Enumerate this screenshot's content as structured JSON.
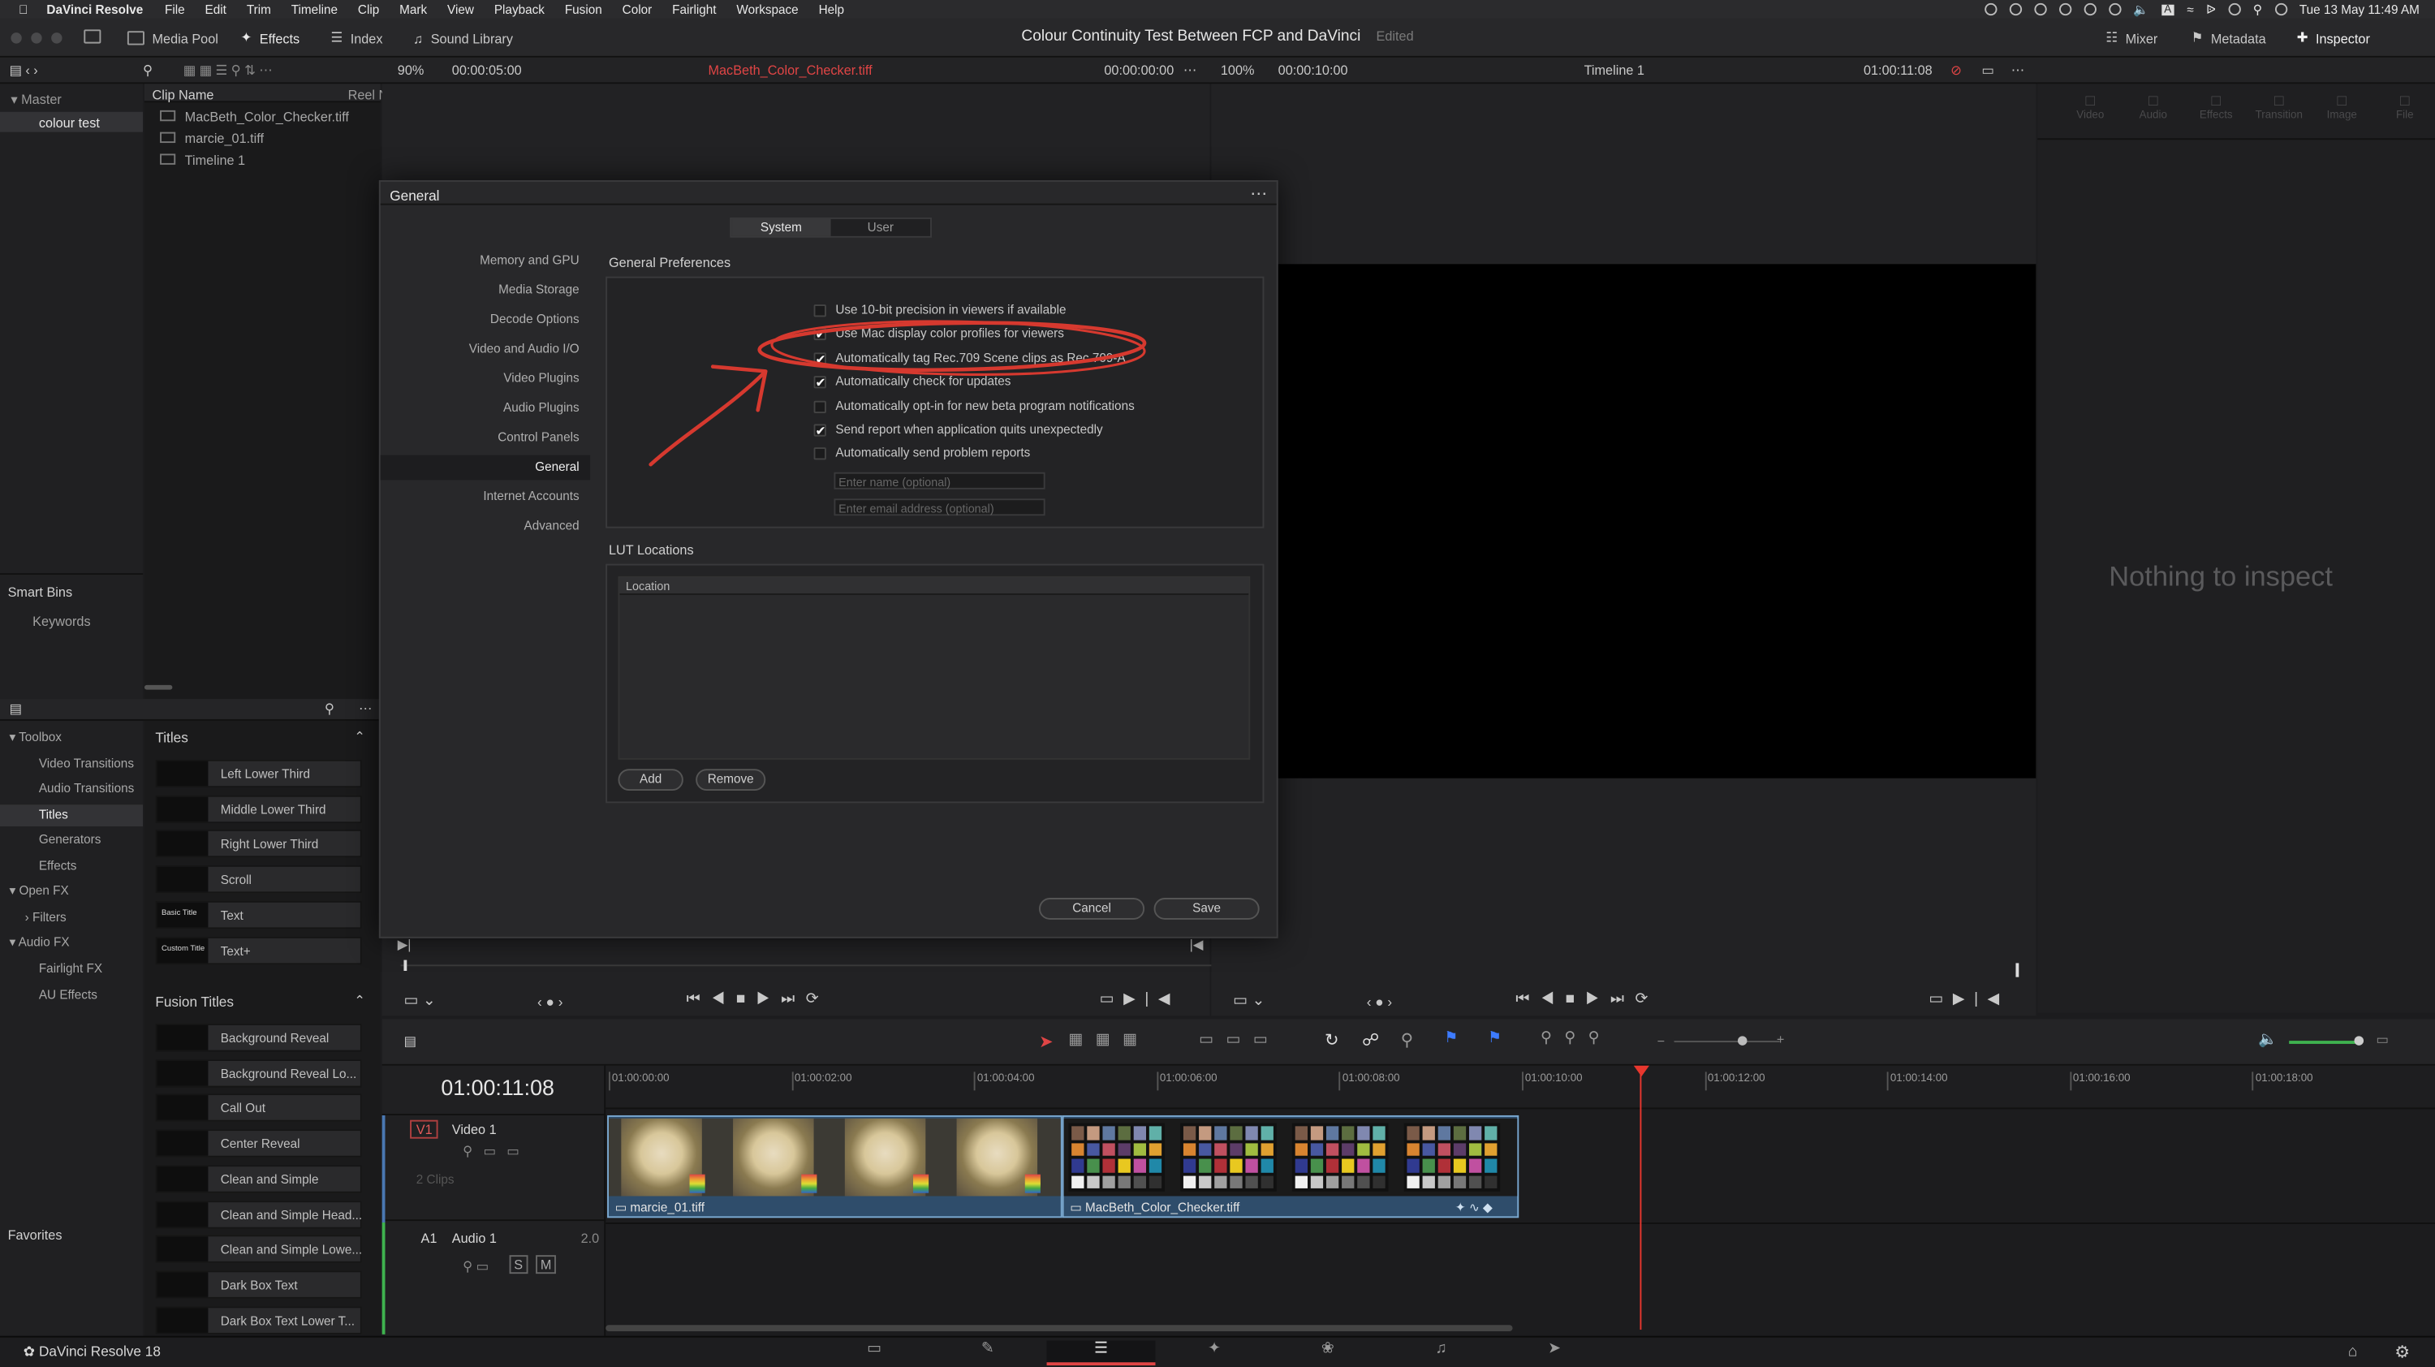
{
  "menubar": {
    "app": "DaVinci Resolve",
    "items": [
      "File",
      "Edit",
      "Trim",
      "Timeline",
      "Clip",
      "Mark",
      "View",
      "Playback",
      "Fusion",
      "Color",
      "Fairlight",
      "Workspace",
      "Help"
    ],
    "datetime": "Tue 13 May  11:49 AM",
    "input_indicator": "A"
  },
  "toolbar": {
    "media_pool": "Media Pool",
    "effects": "Effects",
    "index": "Index",
    "sound_library": "Sound Library",
    "project_title": "Colour Continuity Test Between FCP and DaVinci",
    "edited": "Edited",
    "mixer": "Mixer",
    "metadata": "Metadata",
    "inspector": "Inspector"
  },
  "viewer_header": {
    "source_zoom": "90%",
    "source_duration": "00:00:05:00",
    "source_clip": "MacBeth_Color_Checker.tiff",
    "source_tc": "00:00:00:00",
    "timeline_zoom": "100%",
    "timeline_duration": "00:00:10:00",
    "timeline_name": "Timeline 1",
    "timeline_tc": "01:00:11:08"
  },
  "bins": {
    "master": "Master",
    "selected": "colour test",
    "smart_bins": "Smart Bins",
    "keywords": "Keywords",
    "favorites": "Favorites"
  },
  "media_pool": {
    "col_clip_name": "Clip Name",
    "col_reel": "Reel Na",
    "clips": [
      "MacBeth_Color_Checker.tiff",
      "marcie_01.tiff",
      "Timeline 1"
    ]
  },
  "toolbox": {
    "items": [
      "Toolbox",
      "Video Transitions",
      "Audio Transitions",
      "Titles",
      "Generators",
      "Effects",
      "Open FX",
      "Filters",
      "Audio FX",
      "Fairlight FX",
      "AU Effects"
    ]
  },
  "titles": {
    "header": "Titles",
    "items": [
      "Left Lower Third",
      "Middle Lower Third",
      "Right Lower Third",
      "Scroll",
      "Text",
      "Text+"
    ],
    "thumb_text": [
      "",
      "",
      "",
      "",
      "Basic Title",
      "Custom Title"
    ],
    "fusion_header": "Fusion Titles",
    "fusion_items": [
      "Background Reveal",
      "Background Reveal Lo...",
      "Call Out",
      "Center Reveal",
      "Clean and Simple",
      "Clean and Simple Head...",
      "Clean and Simple Lowe...",
      "Dark Box Text",
      "Dark Box Text Lower T..."
    ]
  },
  "dialog": {
    "title": "General",
    "tabs": [
      "System",
      "User"
    ],
    "active_tab": "System",
    "sidebar": [
      "Memory and GPU",
      "Media Storage",
      "Decode Options",
      "Video and Audio I/O",
      "Video Plugins",
      "Audio Plugins",
      "Control Panels",
      "General",
      "Internet Accounts",
      "Advanced"
    ],
    "active_sidebar": "General",
    "section_general": "General Preferences",
    "options": [
      {
        "label": "Use 10-bit precision in viewers if available",
        "checked": false
      },
      {
        "label": "Use Mac display color profiles for viewers",
        "checked": true
      },
      {
        "label": "Automatically tag Rec.709 Scene clips as Rec.709-A",
        "checked": true
      },
      {
        "label": "Automatically check for updates",
        "checked": true
      },
      {
        "label": "Automatically opt-in for new beta program notifications",
        "checked": false
      },
      {
        "label": "Send report when application quits unexpectedly",
        "checked": true
      },
      {
        "label": "Automatically send problem reports",
        "checked": false
      }
    ],
    "name_placeholder": "Enter name (optional)",
    "email_placeholder": "Enter email address (optional)",
    "section_lut": "LUT Locations",
    "lut_col": "Location",
    "add": "Add",
    "remove": "Remove",
    "cancel": "Cancel",
    "save": "Save"
  },
  "inspector": {
    "tabs": [
      "Video",
      "Audio",
      "Effects",
      "Transition",
      "Image",
      "File"
    ],
    "empty": "Nothing to inspect"
  },
  "timeline": {
    "timecode": "01:00:11:08",
    "ruler": [
      "01:00:00:00",
      "01:00:02:00",
      "01:00:04:00",
      "01:00:06:00",
      "01:00:08:00",
      "01:00:10:00",
      "01:00:12:00",
      "01:00:14:00",
      "01:00:16:00",
      "01:00:18:00"
    ],
    "v1_label": "V1",
    "v1_name": "Video 1",
    "v1_count": "2 Clips",
    "a1_label": "A1",
    "a1_name": "Audio 1",
    "a1_ch": "2.0",
    "solo": "S",
    "mute": "M",
    "clip1": "marcie_01.tiff",
    "clip2": "MacBeth_Color_Checker.tiff"
  },
  "footer": {
    "app_version": "DaVinci Resolve 18"
  },
  "colors": {
    "annotation_red": "#d6392f",
    "source_clip_red": "#e04545",
    "playhead": "#e8372e",
    "clip_blue": "#2f4d6b"
  }
}
